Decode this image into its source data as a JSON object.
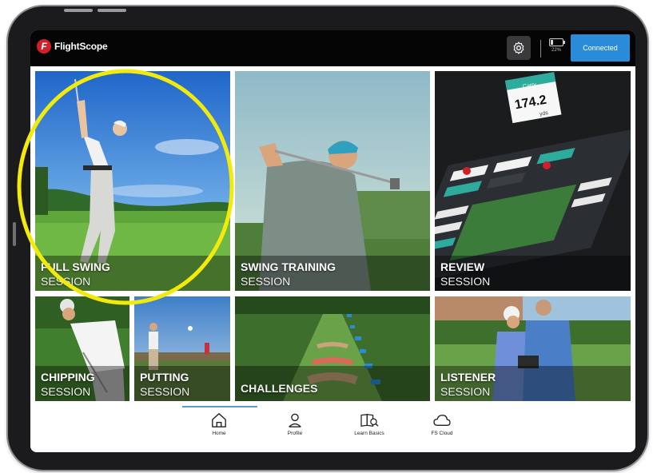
{
  "header": {
    "brand": "FlightScope",
    "battery_percent": "22%",
    "battery_level": 0.22,
    "connect_button": "Connected"
  },
  "tiles": [
    {
      "title": "FULL SWING",
      "subtitle": "SESSION"
    },
    {
      "title": "SWING TRAINING",
      "subtitle": "SESSION"
    },
    {
      "title": "REVIEW",
      "subtitle": "SESSION",
      "overlay": {
        "label": "Carry",
        "value": "174.2",
        "unit": "yds"
      }
    },
    {
      "title": "CHIPPING",
      "subtitle": "SESSION"
    },
    {
      "title": "PUTTING",
      "subtitle": "SESSION"
    },
    {
      "title": "CHALLENGES",
      "subtitle": ""
    },
    {
      "title": "LISTENER",
      "subtitle": "SESSION"
    }
  ],
  "nav": {
    "items": [
      {
        "label": "Home",
        "icon": "home-icon",
        "active": true
      },
      {
        "label": "Profile",
        "icon": "profile-icon",
        "active": false
      },
      {
        "label": "Learn Basics",
        "icon": "learn-basics-icon",
        "active": false
      },
      {
        "label": "FS Cloud",
        "icon": "cloud-icon",
        "active": false
      }
    ]
  },
  "highlight": {
    "shape": "ellipse",
    "color": "#f2ea0c",
    "target": "FULL SWING"
  },
  "colors": {
    "topbar": "#050505",
    "connected": "#2a8bd8",
    "brand_red": "#d0202a",
    "active_tab": "#5b9bd5"
  }
}
